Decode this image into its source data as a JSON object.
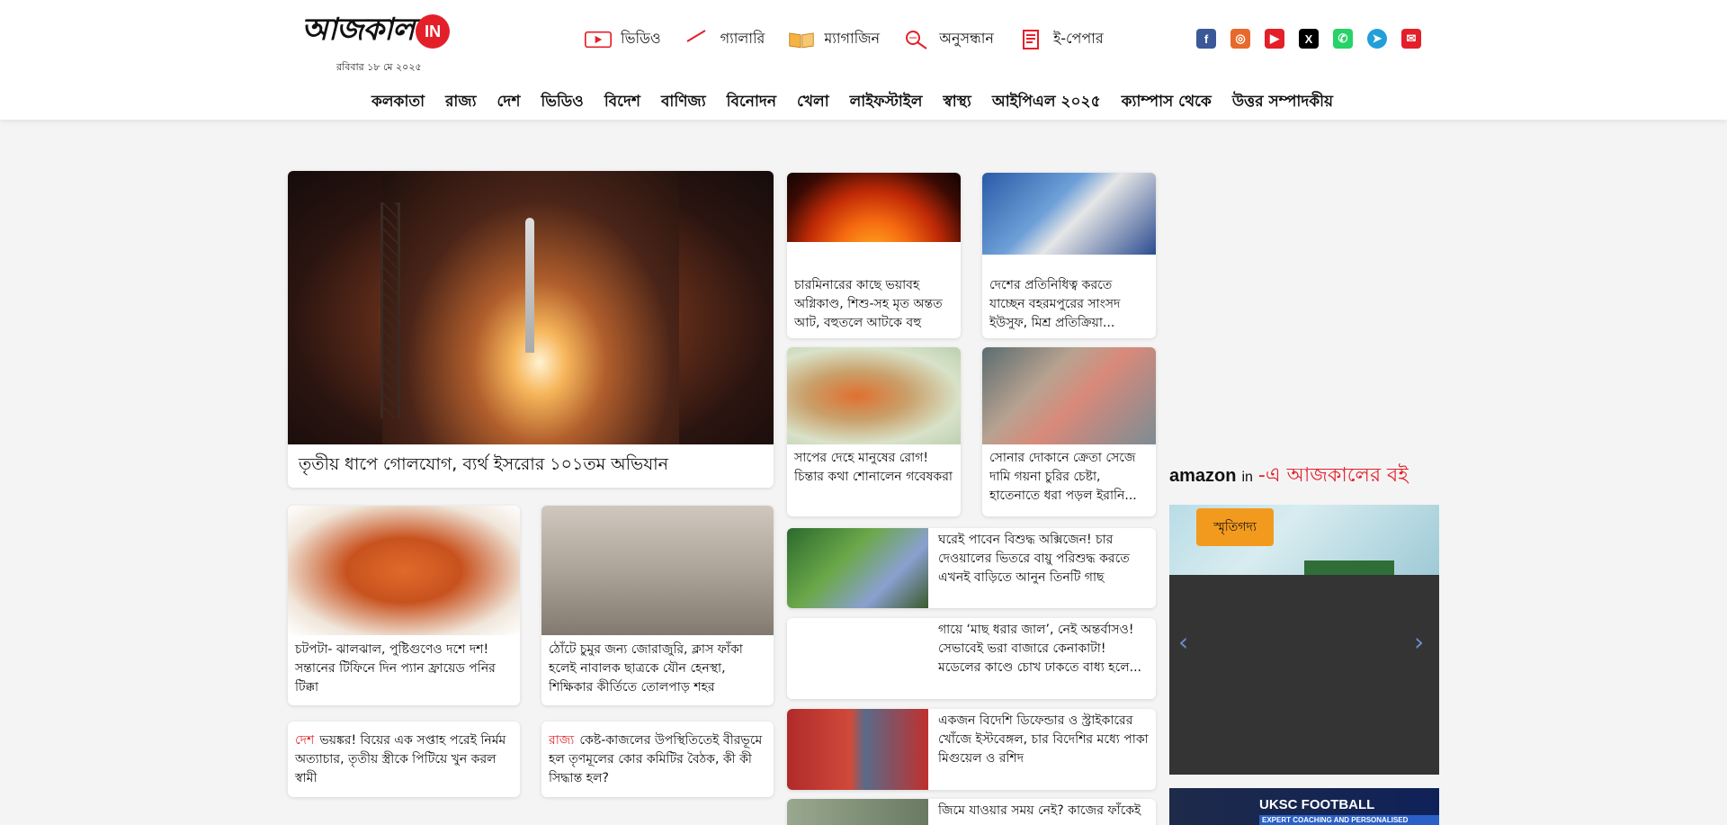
{
  "header": {
    "logo_text": "আজকাল",
    "logo_badge": "IN",
    "date": "রবিবার ১৮ মে ২০২৫",
    "top_nav": [
      {
        "label": "ভিডিও",
        "icon": "video-icon"
      },
      {
        "label": "গ্যালারি",
        "icon": "gallery-icon"
      },
      {
        "label": "ম্যাগাজিন",
        "icon": "magazine-icon"
      },
      {
        "label": "অনুসন্ধান",
        "icon": "search-icon"
      },
      {
        "label": "ই-পেপার",
        "icon": "epaper-icon"
      }
    ],
    "social": [
      {
        "name": "facebook-icon",
        "glyph": "f",
        "color": "#3b5998"
      },
      {
        "name": "instagram-icon",
        "glyph": "◎",
        "color": "#e8692c"
      },
      {
        "name": "youtube-icon",
        "glyph": "▶",
        "color": "#e3202a"
      },
      {
        "name": "x-icon",
        "glyph": "X",
        "color": "#000000"
      },
      {
        "name": "whatsapp-icon",
        "glyph": "✆",
        "color": "#25d366"
      },
      {
        "name": "telegram-icon",
        "glyph": "➤",
        "color": "#229ed9"
      },
      {
        "name": "mail-icon",
        "glyph": "✉",
        "color": "#e3202a"
      }
    ],
    "main_nav": [
      "কলকাতা",
      "রাজ্য",
      "দেশ",
      "ভিডিও",
      "বিদেশ",
      "বাণিজ্য",
      "বিনোদন",
      "খেলা",
      "লাইফস্টাইল",
      "স্বাস্থ্য",
      "আইপিএল ২০২৫",
      "ক্যাম্পাস থেকে",
      "উত্তর সম্পাদকীয়"
    ]
  },
  "hero": {
    "headline": "তৃতীয় ধাপে গোলযোগ, ব্যর্থ ইসরোর ১০১তম অভিযান"
  },
  "grid_stories": [
    {
      "caption": "চারমিনারের কাছে ভয়াবহ অগ্নিকাণ্ড, শিশু-সহ মৃত অন্তত আট, বহুতলে আটকে বহু"
    },
    {
      "caption": "দেশের প্রতিনিধিত্ব করতে যাচ্ছেন বহরমপুরের সাংসদ ইউসুফ, মিশ্র প্রতিক্রিয়া..."
    },
    {
      "caption": "সাপের দেহে মানুষের রোগ! চিন্তার কথা শোনালেন গবেষকরা"
    },
    {
      "caption": "সোনার দোকানে ক্রেতা সেজে দামি গয়না চুরির চেষ্টা, হাতেনাতে ধরা পড়ল ইরানি..."
    }
  ],
  "bottom_stories": [
    {
      "caption": "চটপটা- ঝালঝাল, পুষ্টিগুণেও দশে দশ! সন্তানের টিফিনে দিন প্যান ফ্রায়েড পনির টিক্কা"
    },
    {
      "caption": "ঠোঁটে চুমুর জন্য জোরাজুরি, ক্লাস ফাঁকা হলেই নাবালক ছাত্রকে যৌন হেনস্থা, শিক্ষিকার কীর্তিতে তোলপাড় শহর"
    }
  ],
  "tagged_stories": [
    {
      "tag": "দেশ",
      "text": "ভয়ঙ্কর! বিয়ের এক সপ্তাহ পরেই নির্মম অত্যাচার, তৃতীয় স্ত্রীকে পিটিয়ে খুন করল স্বামী"
    },
    {
      "tag": "রাজ্য",
      "text": "কেষ্ট-কাজলের উপস্থিতিতেই বীরভূমে হল তৃণমূলের কোর কমিটির বৈঠক, কী কী সিদ্ধান্ত হল?"
    }
  ],
  "list_stories": [
    {
      "caption": "ঘরেই পাবেন বিশুদ্ধ অক্সিজেন! চার দেওয়ালের ভিতরে বায়ু পরিশুদ্ধ করতে এখনই বাড়িতে আনুন তিনটি গাছ"
    },
    {
      "caption": "গায়ে ‘মাছ ধরার জাল’, নেই অন্তর্বাসও! সেভাবেই ভরা বাজারে কেনাকাটা! মডেলের কাণ্ডে চোখ ঢাকতে বাধ্য হলে..."
    },
    {
      "caption": "একজন বিদেশি ডিফেন্ডার ও স্ট্রাইকারের খোঁজে ইস্টবেঙ্গল, চার বিদেশির মধ্যে পাকা মিগুয়েল ও রশিদ"
    },
    {
      "caption": "জিমে যাওয়ার সময় নেই? কাজের ফাঁকেই"
    }
  ],
  "amazon": {
    "brand": "amazon",
    "brand_suffix": "in",
    "title": "-এ আজকালের বই",
    "book_badge": "স্মৃতিগদ্য",
    "prev": "‹",
    "next": "›"
  },
  "ad": {
    "title": "UKSC FOOTBALL ACADEMY",
    "subtitle": "EXPERT COACHING AND PERSONALISED TRAINING"
  }
}
